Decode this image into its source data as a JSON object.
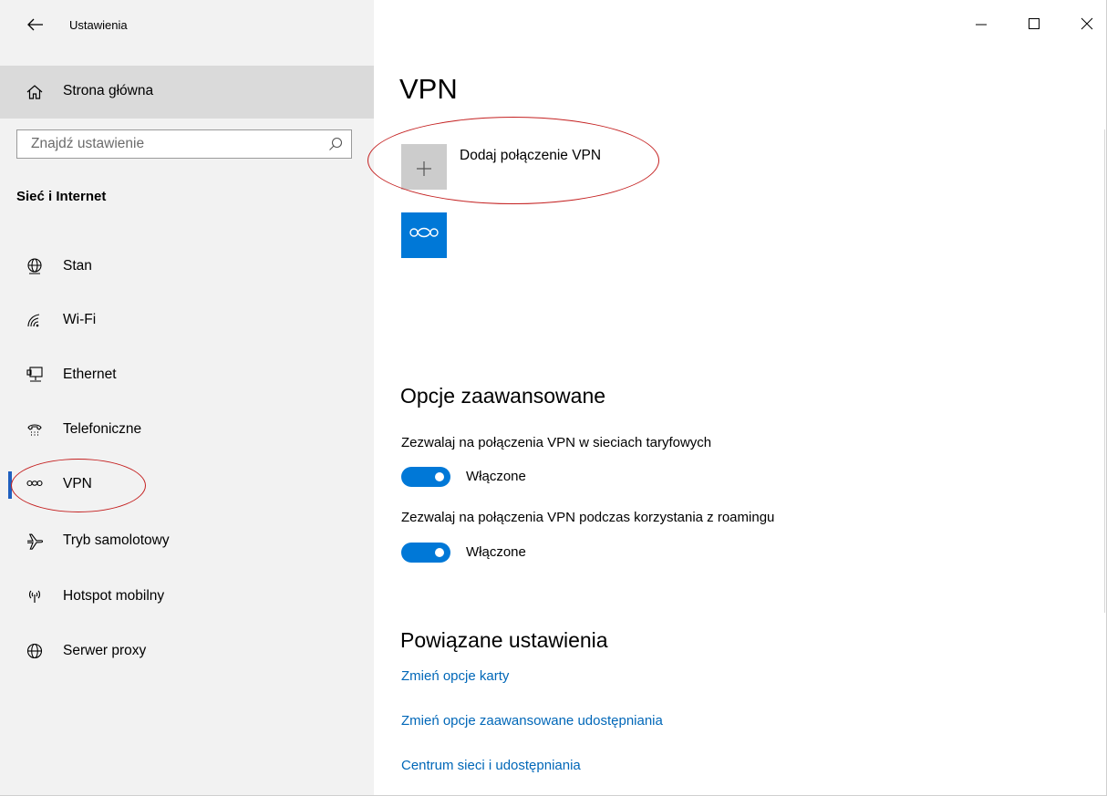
{
  "app": {
    "title": "Ustawienia"
  },
  "sidebar": {
    "home_label": "Strona główna",
    "search_placeholder": "Znajdź ustawienie",
    "section_title": "Sieć i Internet",
    "items": [
      {
        "label": "Stan",
        "icon": "status-globe-icon",
        "selected": false
      },
      {
        "label": "Wi-Fi",
        "icon": "wifi-icon",
        "selected": false
      },
      {
        "label": "Ethernet",
        "icon": "ethernet-icon",
        "selected": false
      },
      {
        "label": "Telefoniczne",
        "icon": "dialup-icon",
        "selected": false
      },
      {
        "label": "VPN",
        "icon": "vpn-icon",
        "selected": true
      },
      {
        "label": "Tryb samolotowy",
        "icon": "airplane-icon",
        "selected": false
      },
      {
        "label": "Hotspot mobilny",
        "icon": "hotspot-icon",
        "selected": false
      },
      {
        "label": "Serwer proxy",
        "icon": "globe-icon",
        "selected": false
      }
    ]
  },
  "main": {
    "title": "VPN",
    "add_vpn_label": "Dodaj połączenie VPN",
    "advanced": {
      "title": "Opcje zaawansowane",
      "settings": [
        {
          "label": "Zezwalaj na połączenia VPN w sieciach taryfowych",
          "state": "Włączone",
          "on": true
        },
        {
          "label": "Zezwalaj na połączenia VPN podczas korzystania z roamingu",
          "state": "Włączone",
          "on": true
        }
      ]
    },
    "related": {
      "title": "Powiązane ustawienia",
      "links": [
        "Zmień opcje karty",
        "Zmień opcje zaawansowane udostępniania",
        "Centrum sieci i udostępniania"
      ]
    }
  },
  "colors": {
    "accent": "#0078d7",
    "link": "#0067b8",
    "sidebar_bg": "#f2f2f2",
    "annotation": "#c42020"
  }
}
